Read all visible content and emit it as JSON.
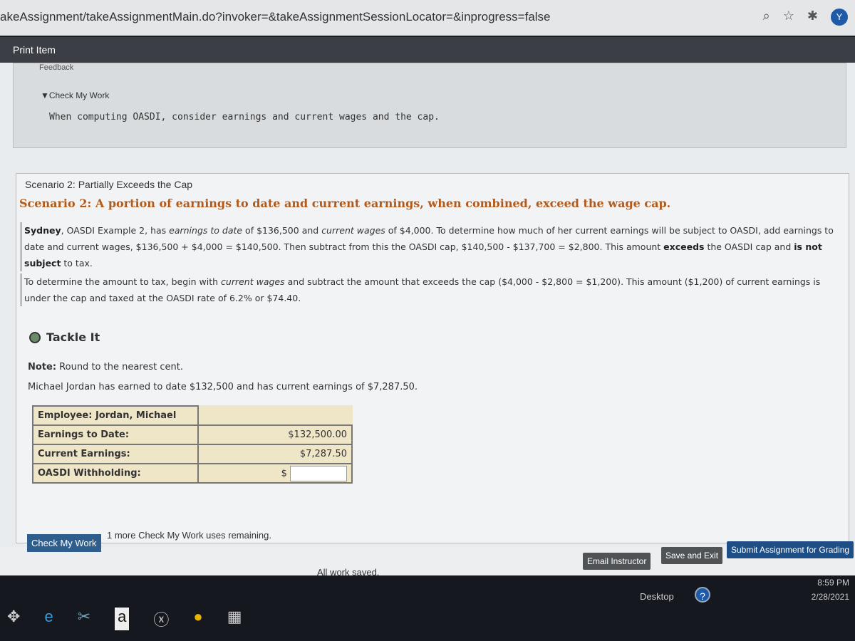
{
  "browser": {
    "url": "akeAssignment/takeAssignmentMain.do?invoker=&takeAssignmentSessionLocator=&inprogress=false",
    "avatar": "Y"
  },
  "print_item": "Print Item",
  "feedback": {
    "title": "Feedback",
    "toggle": "▼Check My Work",
    "hint": "When computing OASDI, consider earnings and current wages and the cap."
  },
  "scenario": {
    "small_title": "Scenario 2: Partially Exceeds the Cap",
    "title": "Scenario 2: A portion of earnings to date and current earnings, when combined, exceed the wage cap.",
    "p1": {
      "name": "Sydney",
      "a": ", OASDI Example 2, has ",
      "e1": "earnings to date",
      "b": " of $136,500 and ",
      "e2": "current wages",
      "c": " of $4,000. To determine how much of her current earnings will be subject to OASDI, add earnings to date and current wages, $136,500 + $4,000 = $140,500. Then subtract from this the OASDI cap, $140,500 - $137,700 = $2,800. This amount ",
      "s1": "exceeds",
      "d": " the OASDI cap and ",
      "s2": "is not subject",
      "e": " to tax."
    },
    "p2": {
      "a": "To determine the amount to tax, begin with ",
      "e1": "current wages",
      "b": " and subtract the amount that exceeds the cap ($4,000 - $2,800 = $1,200). This amount ($1,200) of current earnings is under the cap and taxed at the OASDI rate of 6.2% or $74.40."
    }
  },
  "tackle": {
    "title": "Tackle It",
    "note_label": "Note:",
    "note": " Round to the nearest cent.",
    "given": "Michael Jordan has earned to date $132,500 and has current earnings of $7,287.50."
  },
  "table": {
    "employee": "Employee: Jordan, Michael",
    "rows": [
      {
        "label": "Earnings to Date:",
        "value": "$132,500.00"
      },
      {
        "label": "Current Earnings:",
        "value": "$7,287.50"
      },
      {
        "label": "OASDI Withholding:",
        "prefix": "$",
        "value": ""
      }
    ]
  },
  "footer": {
    "check_my_work": "Check My Work",
    "remaining": "1 more Check My Work uses remaining.",
    "saved": "All work saved.",
    "email": "Email Instructor",
    "save_exit": "Save and Exit",
    "submit": "Submit Assignment for Grading"
  },
  "taskbar": {
    "desktop": "Desktop",
    "help": "?",
    "time": "8:59 PM",
    "date": "2/28/2021"
  }
}
